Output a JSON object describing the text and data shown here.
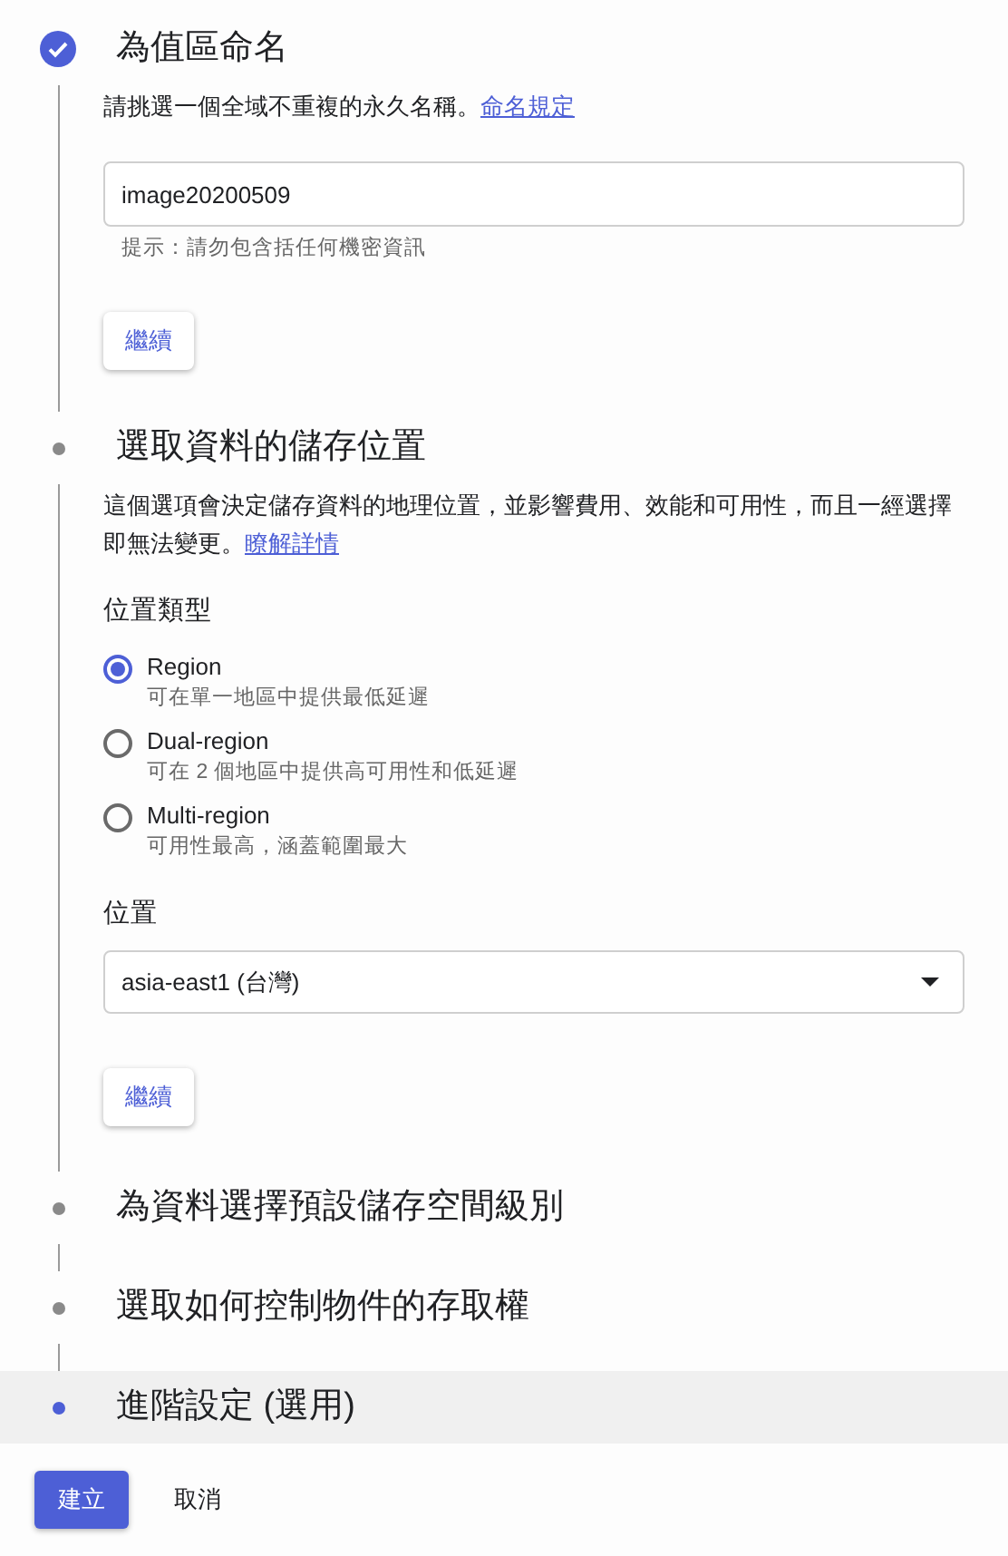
{
  "steps": [
    {
      "title": "為值區命名",
      "completed": true,
      "selected": false,
      "description": "請挑選一個全域不重複的永久名稱。",
      "link": "命名規定",
      "fields": [
        {
          "kind": "text_input",
          "value": "image20200509",
          "hint": "提示：請勿包含括任何機密資訊"
        },
        {
          "kind": "button",
          "label": "繼續"
        }
      ]
    },
    {
      "title": "選取資料的儲存位置",
      "completed": false,
      "selected": false,
      "description": "這個選項會決定儲存資料的地理位置，並影響費用、效能和可用性，而且一經選擇即無法變更。",
      "link": "瞭解詳情",
      "fields": [
        {
          "kind": "radio_group",
          "label": "位置類型",
          "options": [
            {
              "label": "Region",
              "sublabel": "可在單一地區中提供最低延遲",
              "selected": true
            },
            {
              "label": "Dual-region",
              "sublabel": "可在 2 個地區中提供高可用性和低延遲",
              "selected": false
            },
            {
              "label": "Multi-region",
              "sublabel": "可用性最高，涵蓋範圍最大",
              "selected": false
            }
          ]
        },
        {
          "kind": "select",
          "label": "位置",
          "value": "asia-east1 (台灣)"
        },
        {
          "kind": "button",
          "label": "繼續"
        }
      ]
    },
    {
      "title": "為資料選擇預設儲存空間級別",
      "completed": false,
      "selected": false
    },
    {
      "title": "選取如何控制物件的存取權",
      "completed": false,
      "selected": false
    },
    {
      "title": "進階設定 (選用)",
      "completed": false,
      "selected": true
    }
  ],
  "actions": [
    {
      "label": "建立",
      "kind": "primary"
    },
    {
      "label": "取消",
      "kind": "text"
    }
  ]
}
